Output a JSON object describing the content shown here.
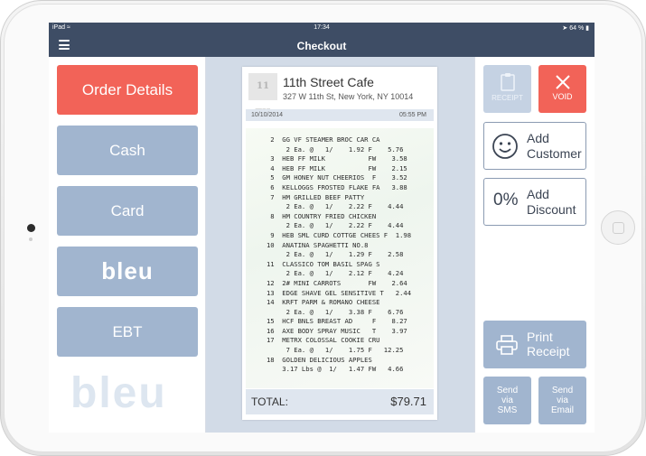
{
  "statusbar": {
    "carrier": "iPad",
    "time": "17:34",
    "battery": "64 %"
  },
  "navbar": {
    "title": "Checkout"
  },
  "left": {
    "order_details": "Order Details",
    "cash": "Cash",
    "card": "Card",
    "bleu": "bleu",
    "ebt": "EBT",
    "watermark": "bleu"
  },
  "receipt": {
    "logo_text": "11 TH",
    "store_name": "11th Street Cafe",
    "address": "327 W 11th St, New York, NY 10014",
    "date": "10/10/2014",
    "time": "05:55 PM",
    "lines": [
      "    2  GG VF STEAMER BROC CAR CA",
      "        2 Ea. @   1/    1.92 F    5.76",
      "    3  HEB FF MILK           FW    3.58",
      "    4  HEB FF MILK           FW    2.15",
      "    5  GM HONEY NUT CHEERIOS  F    3.52",
      "    6  KELLOGGS FROSTED FLAKE FA   3.88",
      "    7  HM GRILLED BEEF PATTY",
      "        2 Ea. @   1/    2.22 F    4.44",
      "    8  HM COUNTRY FRIED CHICKEN",
      "        2 Ea. @   1/    2.22 F    4.44",
      "    9  HEB SML CURD COTTGE CHEES F  1.98",
      "   10  ANATINA SPAGHETTI NO.8",
      "        2 Ea. @   1/    1.29 F    2.58",
      "   11  CLASSICO TOM BASIL SPAG S",
      "        2 Ea. @   1/    2.12 F    4.24",
      "   12  2# MINI CARROTS       FW    2.64",
      "   13  EDGE SHAVE GEL SENSITIVE T   2.44",
      "   14  KRFT PARM & ROMANO CHEESE",
      "        2 Ea. @   1/    3.38 F    6.76",
      "   15  HCF BNLS BREAST AD     F    8.27",
      "   16  AXE BODY SPRAY MUSIC   T    3.97",
      "   17  METRX COLOSSAL COOKIE CRU",
      "        7 Ea. @   1/    1.75 F   12.25",
      "   18  GOLDEN DELICIOUS APPLES",
      "       3.17 Lbs @  1/   1.47 FW   4.66"
    ],
    "total_label": "TOTAL:",
    "total_value": "$79.71"
  },
  "right": {
    "receipt_label": "RECEIPT",
    "void_label": "VOID",
    "add_customer": [
      "Add",
      "Customer"
    ],
    "add_discount_pct": "0%",
    "add_discount": [
      "Add",
      "Discount"
    ],
    "print_receipt": [
      "Print",
      "Receipt"
    ],
    "send_sms": [
      "Send",
      "via",
      "SMS"
    ],
    "send_email": [
      "Send",
      "via",
      "Email"
    ]
  },
  "colors": {
    "nav": "#3e4d65",
    "accent_red": "#f26358",
    "button_blue": "#a1b5cf"
  },
  "icons": [
    "wifi-icon",
    "bluetooth-icon",
    "battery-icon",
    "hamburger-icon",
    "receipt-icon",
    "close-icon",
    "smiley-icon",
    "printer-icon"
  ]
}
